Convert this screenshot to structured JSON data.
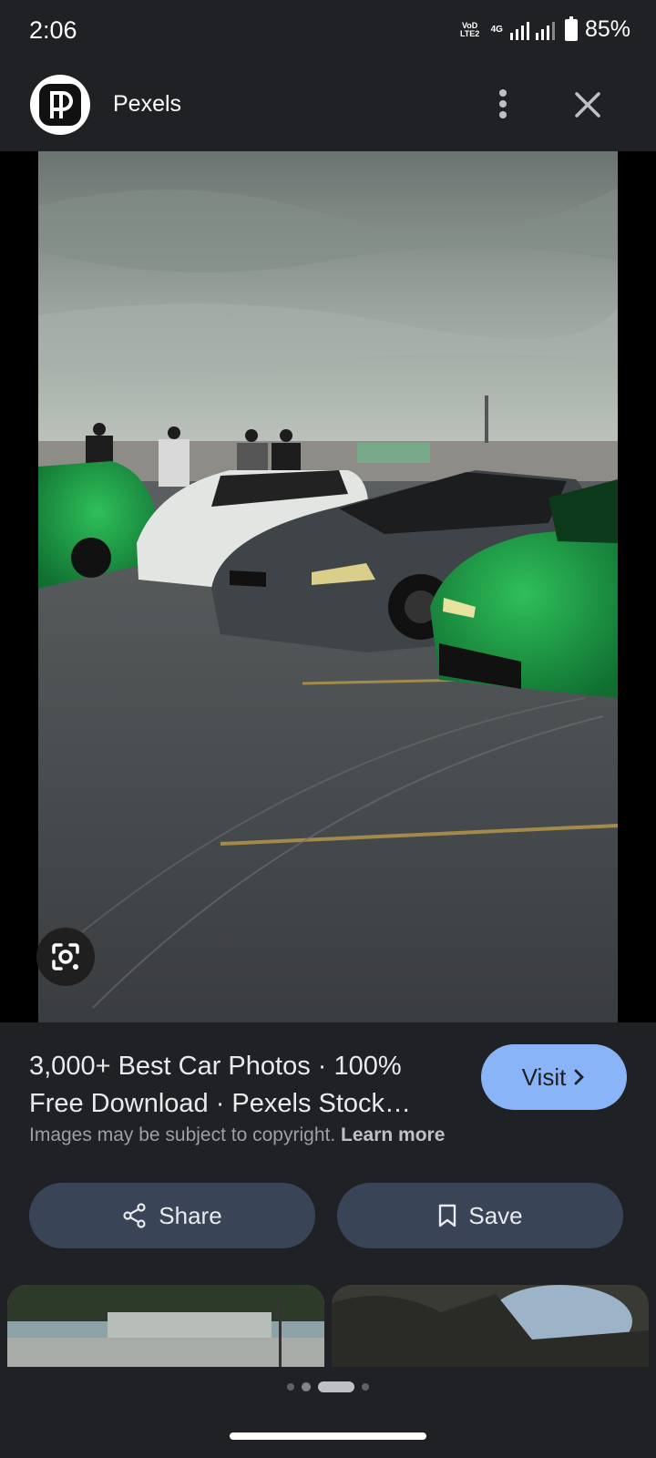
{
  "status_bar": {
    "time": "2:06",
    "net_top": "VoD LTE2",
    "net_gen": "4G",
    "battery": "85%"
  },
  "header": {
    "site_name": "Pexels",
    "logo_icon": "pexels-logo-icon",
    "menu_icon": "more-vert-icon",
    "close_icon": "close-icon"
  },
  "image": {
    "lens_icon": "google-lens-icon"
  },
  "result": {
    "title_line1": "3,000+ Best Car Photos · 100%",
    "title_line2": "Free Download · Pexels Stock…",
    "visit_label": "Visit",
    "copyright_text": "Images may be subject to copyright.",
    "learn_more": "Learn more"
  },
  "actions": {
    "share_label": "Share",
    "save_label": "Save"
  },
  "colors": {
    "background": "#202124",
    "visit_button": "#8ab4f8",
    "action_button": "#394457"
  },
  "pagination": {
    "current_index": 2,
    "count": 4
  }
}
